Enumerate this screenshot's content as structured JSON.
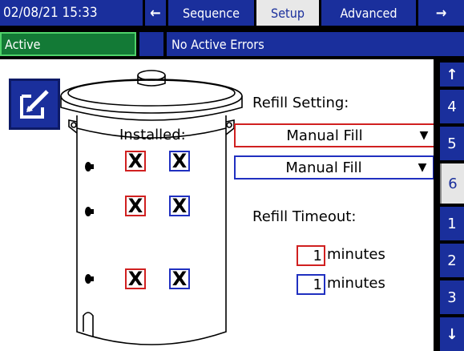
{
  "header": {
    "datetime": "02/08/21 15:33",
    "left_arrow": "←",
    "right_arrow": "→",
    "tabs": [
      {
        "label": "Sequence"
      },
      {
        "label": "Setup"
      },
      {
        "label": "Advanced"
      }
    ]
  },
  "status": {
    "state": "Active",
    "errors": "No Active Errors"
  },
  "sidebar": {
    "up_arrow": "↑",
    "down_arrow": "↓",
    "pages": [
      "4",
      "5",
      "6",
      "1",
      "2",
      "3"
    ],
    "selected": "6"
  },
  "main": {
    "installed_label": "Installed:",
    "refill_setting_label": "Refill Setting:",
    "refill_setting_red": "Manual Fill",
    "refill_setting_blue": "Manual Fill",
    "refill_timeout_label": "Refill Timeout:",
    "timeout_red_value": "1",
    "timeout_blue_value": "1",
    "timeout_unit": "minutes",
    "check_mark": "X"
  },
  "colors": {
    "nav_blue": "#1a2f9c",
    "active_green": "#137a36",
    "red": "#d02020",
    "blue": "#2030c0"
  }
}
